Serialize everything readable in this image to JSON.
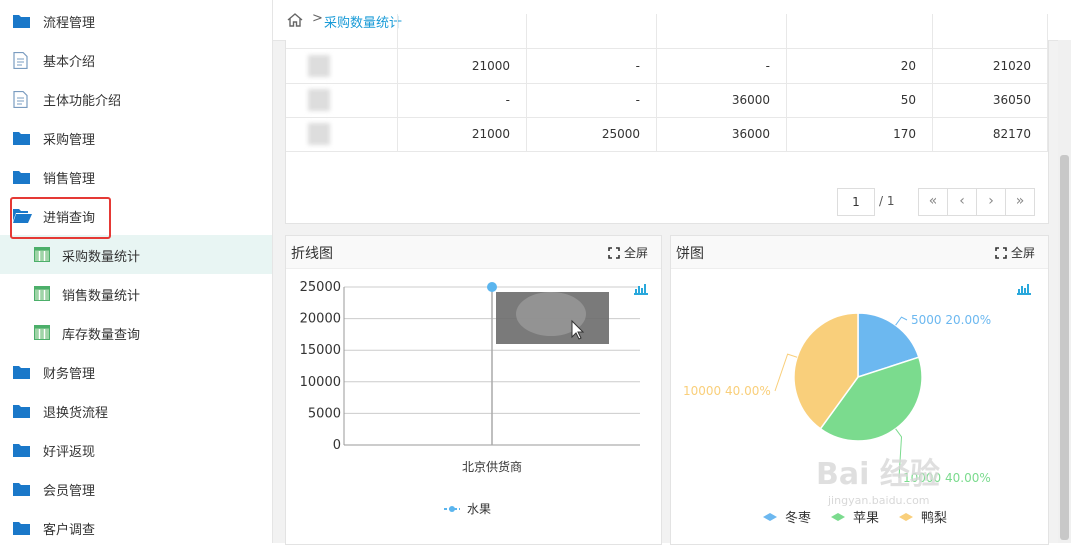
{
  "sidebar": {
    "items": [
      {
        "label": "流程管理",
        "icon": "folder-icon",
        "sub": false,
        "active": false
      },
      {
        "label": "基本介绍",
        "icon": "document-icon",
        "sub": false,
        "active": false
      },
      {
        "label": "主体功能介绍",
        "icon": "document-icon",
        "sub": false,
        "active": false
      },
      {
        "label": "采购管理",
        "icon": "folder-icon",
        "sub": false,
        "active": false
      },
      {
        "label": "销售管理",
        "icon": "folder-icon",
        "sub": false,
        "active": false
      },
      {
        "label": "进销查询",
        "icon": "folder-open-icon",
        "sub": false,
        "active": false
      },
      {
        "label": "采购数量统计",
        "icon": "table-icon",
        "sub": true,
        "active": true
      },
      {
        "label": "销售数量统计",
        "icon": "table-icon",
        "sub": true,
        "active": false
      },
      {
        "label": "库存数量查询",
        "icon": "table-icon",
        "sub": true,
        "active": false
      },
      {
        "label": "财务管理",
        "icon": "folder-icon",
        "sub": false,
        "active": false
      },
      {
        "label": "退换货流程",
        "icon": "folder-icon",
        "sub": false,
        "active": false
      },
      {
        "label": "好评返现",
        "icon": "folder-icon",
        "sub": false,
        "active": false
      },
      {
        "label": "会员管理",
        "icon": "folder-icon",
        "sub": false,
        "active": false
      },
      {
        "label": "客户调查",
        "icon": "folder-icon",
        "sub": false,
        "active": false
      }
    ]
  },
  "breadcrumb": {
    "current": "采购数量统计",
    "sep": ">"
  },
  "table": {
    "rows": [
      [
        "",
        "21000",
        "-",
        "-",
        "20",
        "21020"
      ],
      [
        "",
        "-",
        "-",
        "36000",
        "50",
        "36050"
      ],
      [
        "",
        "21000",
        "25000",
        "36000",
        "170",
        "82170"
      ]
    ]
  },
  "pager": {
    "page": "1",
    "total": "/ 1",
    "first": "«",
    "prev": "‹",
    "next": "›",
    "last": "»"
  },
  "line_panel": {
    "title": "折线图",
    "fullscreen": "全屏"
  },
  "pie_panel": {
    "title": "饼图",
    "fullscreen": "全屏"
  },
  "colors": {
    "accent": "#1a9bd7",
    "pie_dongzao": "#6cb8f0",
    "pie_pingguo": "#7bdb8e",
    "pie_yali": "#f9cf7b"
  },
  "chart_data": [
    {
      "type": "line",
      "x": [
        "北京供货商"
      ],
      "ylim": [
        0,
        25000
      ],
      "yticks": [
        "25000",
        "20000",
        "15000",
        "10000",
        "5000",
        "0"
      ],
      "series": [
        {
          "name": "水果",
          "values": [
            25000
          ]
        }
      ],
      "legend": "bottom"
    },
    {
      "type": "pie",
      "labels": [
        "冬枣",
        "苹果",
        "鸭梨"
      ],
      "values": [
        5000,
        10000,
        10000
      ],
      "slice_labels": [
        "5000 20.00%",
        "10000 40.00%",
        "10000 40.00%"
      ],
      "legend": "bottom"
    }
  ],
  "watermark": {
    "text": "Bai 经验",
    "sub": "jingyan.baidu.com"
  }
}
